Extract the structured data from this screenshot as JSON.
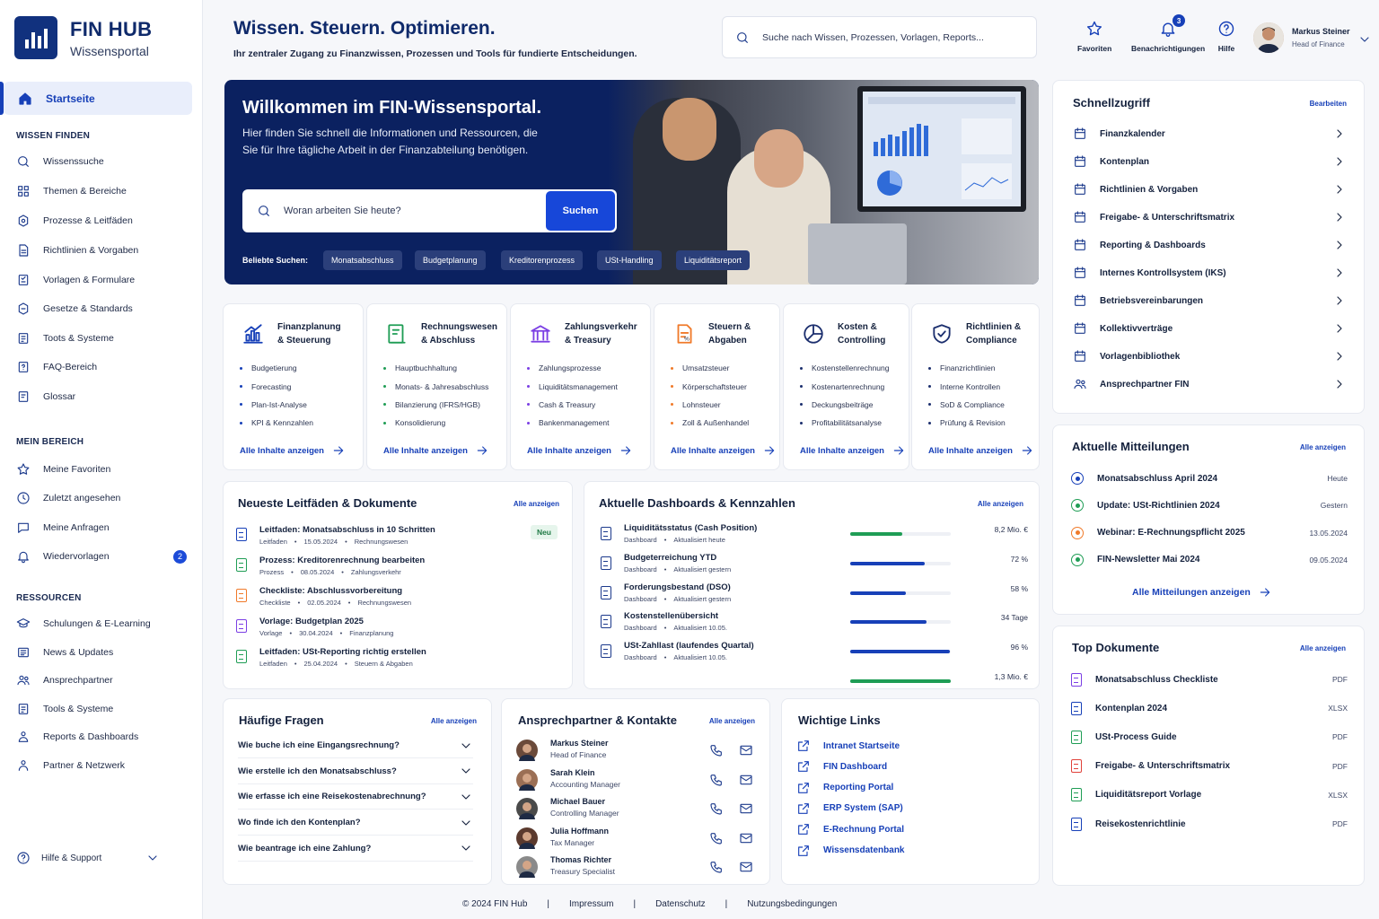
{
  "brand": {
    "name": "FIN HUB",
    "subtitle": "Wissensportal"
  },
  "sidebar": {
    "home": "Startseite",
    "sections": [
      {
        "title": "WISSEN FINDEN",
        "items": [
          {
            "label": "Wissenssuche",
            "icon": "search-icon"
          },
          {
            "label": "Themen & Bereiche",
            "icon": "grid-icon"
          },
          {
            "label": "Prozesse & Leitfäden",
            "icon": "process-icon"
          },
          {
            "label": "Richtlinien & Vorgaben",
            "icon": "document-icon"
          },
          {
            "label": "Vorlagen & Formulare",
            "icon": "template-icon"
          },
          {
            "label": "Gesetze & Standards",
            "icon": "law-icon"
          },
          {
            "label": "Toots & Systeme",
            "icon": "tools-icon"
          },
          {
            "label": "FAQ-Bereich",
            "icon": "faq-icon"
          },
          {
            "label": "Glossar",
            "icon": "glossary-icon"
          }
        ]
      },
      {
        "title": "MEIN BEREICH",
        "items": [
          {
            "label": "Meine Favoriten",
            "icon": "star-icon"
          },
          {
            "label": "Zuletzt angesehen",
            "icon": "clock-icon"
          },
          {
            "label": "Meine Anfragen",
            "icon": "chat-icon"
          },
          {
            "label": "Wiedervorlagen",
            "icon": "bell-icon",
            "badge": "2"
          }
        ]
      },
      {
        "title": "RESSOURCEN",
        "items": [
          {
            "label": "Schulungen & E-Learning",
            "icon": "graduation-icon"
          },
          {
            "label": "News & Updates",
            "icon": "news-icon"
          },
          {
            "label": "Ansprechpartner",
            "icon": "people-icon"
          },
          {
            "label": "Tools & Systeme",
            "icon": "tools-icon"
          },
          {
            "label": "Reports & Dashboards",
            "icon": "report-icon"
          },
          {
            "label": "Partner & Netzwerk",
            "icon": "network-icon"
          }
        ]
      }
    ],
    "help": "Hilfe & Support"
  },
  "header": {
    "title": "Wissen. Steuern. Optimieren.",
    "subtitle": "Ihr zentraler Zugang zu Finanzwissen, Prozessen und Tools für fundierte Entscheidungen.",
    "search_placeholder": "Suche nach Wissen, Prozessen, Vorlagen, Reports...",
    "favorites": "Favoriten",
    "notifications": "Benachrichtigungen",
    "notif_count": "3",
    "help": "Hilfe",
    "user_name": "Markus Steiner",
    "user_role": "Head of Finance"
  },
  "hero": {
    "title": "Willkommen im FIN-Wissensportal.",
    "text": "Hier finden Sie schnell die Informationen und Ressourcen, die Sie für Ihre tägliche Arbeit in der Finanzabteilung benötigen.",
    "search_placeholder": "Woran arbeiten Sie heute?",
    "search_button": "Suchen",
    "popular_label": "Beliebte Suchen:",
    "chips": [
      "Monatsabschluss",
      "Budgetplanung",
      "Kreditorenprozess",
      "USt-Handling",
      "Liquiditätsreport"
    ]
  },
  "categories": [
    {
      "title": "Finanzplanung\n& Steuerung",
      "color": "#1740b8",
      "icon": "chart-icon",
      "items": [
        "Budgetierung",
        "Forecasting",
        "Plan-Ist-Analyse",
        "KPI & Kennzahlen"
      ],
      "more": "Alle Inhalte anzeigen"
    },
    {
      "title": "Rechnungswesen\n& Abschluss",
      "color": "#1f9d55",
      "icon": "ledger-icon",
      "items": [
        "Hauptbuchhaltung",
        "Monats- & Jahresabschluss",
        "Bilanzierung (IFRS/HGB)",
        "Konsolidierung"
      ],
      "more": "Alle Inhalte anzeigen"
    },
    {
      "title": "Zahlungsverkehr\n& Treasury",
      "color": "#7b3fe4",
      "icon": "bank-icon",
      "items": [
        "Zahlungsprozesse",
        "Liquiditätsmanagement",
        "Cash & Treasury",
        "Bankenmanagement"
      ],
      "more": "Alle Inhalte anzeigen"
    },
    {
      "title": "Steuern &\nAbgaben",
      "color": "#f07a2a",
      "icon": "tax-icon",
      "items": [
        "Umsatzsteuer",
        "Körperschaftsteuer",
        "Lohnsteuer",
        "Zoll & Außenhandel"
      ],
      "more": "Alle Inhalte anzeigen"
    },
    {
      "title": "Kosten &\nControlling",
      "color": "#1c2f6e",
      "icon": "pie-icon",
      "items": [
        "Kostenstellenrechnung",
        "Kostenartenrechnung",
        "Deckungsbeiträge",
        "Profitabilitätsanalyse"
      ],
      "more": "Alle Inhalte anzeigen"
    },
    {
      "title": "Richtlinien &\nCompliance",
      "color": "#1c2f6e",
      "icon": "shield-icon",
      "items": [
        "Finanzrichtlinien",
        "Interne Kontrollen",
        "SoD & Compliance",
        "Prüfung & Revision"
      ],
      "more": "Alle Inhalte anzeigen"
    }
  ],
  "docs": {
    "title": "Neueste Leitfäden & Dokumente",
    "link": "Alle anzeigen",
    "badge": "Neu",
    "items": [
      {
        "title": "Leitfaden: Monatsabschluss in 10 Schritten",
        "type": "Leitfaden",
        "date": "15.05.2024",
        "area": "Rechnungswesen",
        "color": "#1740b8"
      },
      {
        "title": "Prozess: Kreditorenrechnung bearbeiten",
        "type": "Prozess",
        "date": "08.05.2024",
        "area": "Zahlungsverkehr",
        "color": "#1f9d55"
      },
      {
        "title": "Checkliste: Abschlussvorbereitung",
        "type": "Checkliste",
        "date": "02.05.2024",
        "area": "Rechnungswesen",
        "color": "#f07a2a"
      },
      {
        "title": "Vorlage: Budgetplan 2025",
        "type": "Vorlage",
        "date": "30.04.2024",
        "area": "Finanzplanung",
        "color": "#7b3fe4"
      },
      {
        "title": "Leitfaden: USt-Reporting richtig erstellen",
        "type": "Leitfaden",
        "date": "25.04.2024",
        "area": "Steuern & Abgaben",
        "color": "#1f9d55"
      }
    ]
  },
  "dashboards": {
    "title": "Aktuelle Dashboards & Kennzahlen",
    "link": "Alle anzeigen",
    "items": [
      {
        "title": "Liquiditätsstatus (Cash Position)",
        "type": "Dashboard",
        "updated": "Aktualisiert heute",
        "value": "8,2 Mio. €",
        "fill": 0.52,
        "color": "#1f9d55"
      },
      {
        "title": "Budgeterreichung YTD",
        "type": "Dashboard",
        "updated": "Aktualisiert gestern",
        "value": "72 %",
        "fill": 0.74,
        "color": "#1740b8"
      },
      {
        "title": "Forderungsbestand (DSO)",
        "type": "Dashboard",
        "updated": "Aktualisiert gestern",
        "value": "58 %",
        "fill": 0.55,
        "color": "#1740b8"
      },
      {
        "title": "Kostenstellenübersicht",
        "type": "Dashboard",
        "updated": "Aktualisiert 10.05.",
        "value": "34 Tage",
        "fill": 0.76,
        "color": "#1740b8"
      },
      {
        "title": "USt-Zahllast (laufendes Quartal)",
        "type": "Dashboard",
        "updated": "Aktualisiert 10.05.",
        "value": "96 %",
        "fill": 0.99,
        "color": "#1740b8"
      },
      {
        "title": "",
        "type": "",
        "updated": "",
        "value": "1,3 Mio. €",
        "fill": 1.0,
        "color": "#1f9d55"
      }
    ]
  },
  "faq": {
    "title": "Häufige Fragen",
    "link": "Alle anzeigen",
    "items": [
      "Wie buche ich eine Eingangsrechnung?",
      "Wie erstelle ich den Monatsabschluss?",
      "Wie erfasse ich eine Reisekostenabrechnung?",
      "Wo finde ich den Kontenplan?",
      "Wie beantrage ich eine Zahlung?"
    ]
  },
  "contacts": {
    "title": "Ansprechpartner & Kontakte",
    "link": "Alle anzeigen",
    "items": [
      {
        "name": "Markus Steiner",
        "role": "Head of Finance",
        "color": "#6b4a3a"
      },
      {
        "name": "Sarah Klein",
        "role": "Accounting Manager",
        "color": "#9b6f55"
      },
      {
        "name": "Michael Bauer",
        "role": "Controlling Manager",
        "color": "#4a4a4a"
      },
      {
        "name": "Julia Hoffmann",
        "role": "Tax Manager",
        "color": "#5b3a2e"
      },
      {
        "name": "Thomas Richter",
        "role": "Treasury Specialist",
        "color": "#8a8a8a"
      }
    ]
  },
  "links": {
    "title": "Wichtige Links",
    "items": [
      "Intranet Startseite",
      "FIN Dashboard",
      "Reporting Portal",
      "ERP System (SAP)",
      "E-Rechnung Portal",
      "Wissensdatenbank"
    ]
  },
  "quick": {
    "title": "Schnellzugriff",
    "edit": "Bearbeiten",
    "items": [
      "Finanzkalender",
      "Kontenplan",
      "Richtlinien & Vorgaben",
      "Freigabe- & Unterschriftsmatrix",
      "Reporting & Dashboards",
      "Internes Kontrollsystem (IKS)",
      "Betriebsvereinbarungen",
      "Kollektivverträge",
      "Vorlagenbibliothek",
      "Ansprechpartner FIN"
    ]
  },
  "messages": {
    "title": "Aktuelle Mitteilungen",
    "link": "Alle anzeigen",
    "more": "Alle Mitteilungen anzeigen",
    "items": [
      {
        "title": "Monatsabschluss April 2024",
        "date": "Heute",
        "color": "#1740b8"
      },
      {
        "title": "Update: USt-Richtlinien 2024",
        "date": "Gestern",
        "color": "#1f9d55"
      },
      {
        "title": "Webinar: E-Rechnungspflicht 2025",
        "date": "13.05.2024",
        "color": "#f07a2a"
      },
      {
        "title": "FIN-Newsletter Mai 2024",
        "date": "09.05.2024",
        "color": "#1f9d55"
      }
    ]
  },
  "topdocs": {
    "title": "Top Dokumente",
    "link": "Alle anzeigen",
    "items": [
      {
        "title": "Monatsabschluss Checkliste",
        "ext": "PDF",
        "color": "#7b3fe4"
      },
      {
        "title": "Kontenplan 2024",
        "ext": "XLSX",
        "color": "#1740b8"
      },
      {
        "title": "USt-Process Guide",
        "ext": "PDF",
        "color": "#1f9d55"
      },
      {
        "title": "Freigabe- & Unterschriftsmatrix",
        "ext": "PDF",
        "color": "#e0413a"
      },
      {
        "title": "Liquiditätsreport Vorlage",
        "ext": "XLSX",
        "color": "#1f9d55"
      },
      {
        "title": "Reisekostenrichtlinie",
        "ext": "PDF",
        "color": "#1740b8"
      }
    ]
  },
  "footer": [
    "© 2024 FIN Hub",
    "|",
    "Impressum",
    "|",
    "Datenschutz",
    "|",
    "Nutzungsbedingungen"
  ]
}
